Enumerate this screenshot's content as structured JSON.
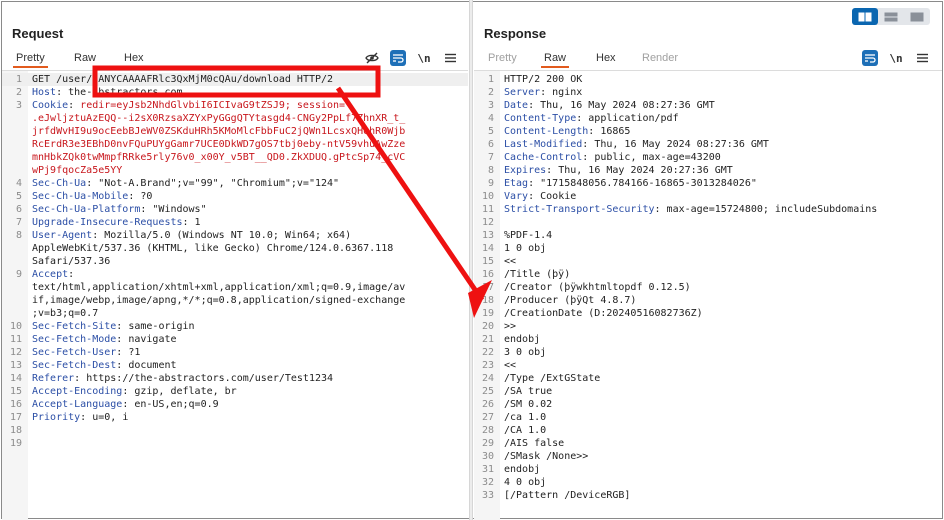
{
  "request": {
    "title": "Request",
    "tabs": [
      {
        "label": "Pretty",
        "active": true,
        "muted": false
      },
      {
        "label": "Raw",
        "active": false,
        "muted": false
      },
      {
        "label": "Hex",
        "active": false,
        "muted": false
      }
    ],
    "newline_label": "\\n",
    "icons": [
      "eye-slash-icon",
      "wrap-icon",
      "menu-icon"
    ],
    "lines": [
      {
        "n": "1",
        "segs": [
          {
            "t": "GET /use",
            "c": "pl"
          },
          {
            "t": "r",
            "c": "pl"
          },
          {
            "t": "/gANYCAAAAFRlc3QxMjM0cQAu/download HTTP/2",
            "c": "pl"
          }
        ]
      },
      {
        "n": "2",
        "segs": [
          {
            "t": "Host",
            "c": "k"
          },
          {
            "t": ": the-abstractors.com",
            "c": "pl"
          }
        ]
      },
      {
        "n": "3",
        "segs": [
          {
            "t": "Cookie",
            "c": "k"
          },
          {
            "t": ": ",
            "c": "pl"
          },
          {
            "t": "redir=eyJsb2NhdGlvbiI6ICIvaG9tZSJ9; session=",
            "c": "cv"
          }
        ]
      },
      {
        "n": "",
        "segs": [
          {
            "t": ".eJwljztuAzEQQ--i2sX0RzsaXZYxPyGGgQTYtasgd4-CNGy2PpLf7ZhnXR_t_",
            "c": "cv"
          }
        ]
      },
      {
        "n": "",
        "segs": [
          {
            "t": "jrfdWvHI9u9ocEebBJeWV0ZSKduHRh5KMoMlcFbbFuC2jQWn1LcsxQHohR0Wjb",
            "c": "cv"
          }
        ]
      },
      {
        "n": "",
        "segs": [
          {
            "t": "RcErdR3e3EBhD0nvFQuPUYgGamr7UCE0DkWD7gOS7tbj0eby-ntV59vhuAwZze",
            "c": "cv"
          }
        ]
      },
      {
        "n": "",
        "segs": [
          {
            "t": "mnHbkZQk0twMmpfRRke5rly76v0_x00Y_v5BT__QD0.ZkXDUQ.gPtcSp74_cVC",
            "c": "cv"
          }
        ]
      },
      {
        "n": "",
        "segs": [
          {
            "t": "wPj9fqocZa5e5YY",
            "c": "cv"
          }
        ]
      },
      {
        "n": "4",
        "segs": [
          {
            "t": "Sec-Ch-Ua",
            "c": "k"
          },
          {
            "t": ": \"Not-A.Brand\";v=\"99\", \"Chromium\";v=\"124\"",
            "c": "pl"
          }
        ]
      },
      {
        "n": "5",
        "segs": [
          {
            "t": "Sec-Ch-Ua-Mobile",
            "c": "k"
          },
          {
            "t": ": ?0",
            "c": "pl"
          }
        ]
      },
      {
        "n": "6",
        "segs": [
          {
            "t": "Sec-Ch-Ua-Platform",
            "c": "k"
          },
          {
            "t": ": \"Windows\"",
            "c": "pl"
          }
        ]
      },
      {
        "n": "7",
        "segs": [
          {
            "t": "Upgrade-Insecure-Requests",
            "c": "k"
          },
          {
            "t": ": 1",
            "c": "pl"
          }
        ]
      },
      {
        "n": "8",
        "segs": [
          {
            "t": "User-Agent",
            "c": "k"
          },
          {
            "t": ": Mozilla/5.0 (Windows NT 10.0; Win64; x64)",
            "c": "pl"
          }
        ]
      },
      {
        "n": "",
        "segs": [
          {
            "t": "AppleWebKit/537.36 (KHTML, like Gecko) Chrome/124.0.6367.118",
            "c": "pl"
          }
        ]
      },
      {
        "n": "",
        "segs": [
          {
            "t": "Safari/537.36",
            "c": "pl"
          }
        ]
      },
      {
        "n": "9",
        "segs": [
          {
            "t": "Accept",
            "c": "k"
          },
          {
            "t": ":",
            "c": "pl"
          }
        ]
      },
      {
        "n": "",
        "segs": [
          {
            "t": "text/html,application/xhtml+xml,application/xml;q=0.9,image/av",
            "c": "pl"
          }
        ]
      },
      {
        "n": "",
        "segs": [
          {
            "t": "if,image/webp,image/apng,*/*;q=0.8,application/signed-exchange",
            "c": "pl"
          }
        ]
      },
      {
        "n": "",
        "segs": [
          {
            "t": ";v=b3;q=0.7",
            "c": "pl"
          }
        ]
      },
      {
        "n": "10",
        "segs": [
          {
            "t": "Sec-Fetch-Site",
            "c": "k"
          },
          {
            "t": ": same-origin",
            "c": "pl"
          }
        ]
      },
      {
        "n": "11",
        "segs": [
          {
            "t": "Sec-Fetch-Mode",
            "c": "k"
          },
          {
            "t": ": navigate",
            "c": "pl"
          }
        ]
      },
      {
        "n": "12",
        "segs": [
          {
            "t": "Sec-Fetch-User",
            "c": "k"
          },
          {
            "t": ": ?1",
            "c": "pl"
          }
        ]
      },
      {
        "n": "13",
        "segs": [
          {
            "t": "Sec-Fetch-Dest",
            "c": "k"
          },
          {
            "t": ": document",
            "c": "pl"
          }
        ]
      },
      {
        "n": "14",
        "segs": [
          {
            "t": "Referer",
            "c": "k"
          },
          {
            "t": ": https://the-abstractors.com/user/Test1234",
            "c": "pl"
          }
        ]
      },
      {
        "n": "15",
        "segs": [
          {
            "t": "Accept-Encoding",
            "c": "k"
          },
          {
            "t": ": gzip, deflate, br",
            "c": "pl"
          }
        ]
      },
      {
        "n": "16",
        "segs": [
          {
            "t": "Accept-Language",
            "c": "k"
          },
          {
            "t": ": en-US,en;q=0.9",
            "c": "pl"
          }
        ]
      },
      {
        "n": "17",
        "segs": [
          {
            "t": "Priority",
            "c": "k"
          },
          {
            "t": ": u=0, i",
            "c": "pl"
          }
        ]
      },
      {
        "n": "18",
        "segs": []
      },
      {
        "n": "19",
        "segs": []
      }
    ]
  },
  "response": {
    "title": "Response",
    "tabs": [
      {
        "label": "Pretty",
        "active": false,
        "muted": true
      },
      {
        "label": "Raw",
        "active": true,
        "muted": false
      },
      {
        "label": "Hex",
        "active": false,
        "muted": false
      },
      {
        "label": "Render",
        "active": false,
        "muted": true
      }
    ],
    "newline_label": "\\n",
    "icons": [
      "wrap-icon",
      "menu-icon"
    ],
    "lines": [
      {
        "n": "1",
        "segs": [
          {
            "t": "HTTP/2 200 OK",
            "c": "pl"
          }
        ]
      },
      {
        "n": "2",
        "segs": [
          {
            "t": "Server",
            "c": "k"
          },
          {
            "t": ": nginx",
            "c": "pl"
          }
        ]
      },
      {
        "n": "3",
        "segs": [
          {
            "t": "Date",
            "c": "k"
          },
          {
            "t": ": Thu, 16 May 2024 08:27:36 GMT",
            "c": "pl"
          }
        ]
      },
      {
        "n": "4",
        "segs": [
          {
            "t": "Content-Type",
            "c": "k"
          },
          {
            "t": ": application/pdf",
            "c": "pl"
          }
        ]
      },
      {
        "n": "5",
        "segs": [
          {
            "t": "Content-Length",
            "c": "k"
          },
          {
            "t": ": 16865",
            "c": "pl"
          }
        ]
      },
      {
        "n": "6",
        "segs": [
          {
            "t": "Last-Modified",
            "c": "k"
          },
          {
            "t": ": Thu, 16 May 2024 08:27:36 GMT",
            "c": "pl"
          }
        ]
      },
      {
        "n": "7",
        "segs": [
          {
            "t": "Cache-Control",
            "c": "k"
          },
          {
            "t": ": public, max-age=43200",
            "c": "pl"
          }
        ]
      },
      {
        "n": "8",
        "segs": [
          {
            "t": "Expires",
            "c": "k"
          },
          {
            "t": ": Thu, 16 May 2024 20:27:36 GMT",
            "c": "pl"
          }
        ]
      },
      {
        "n": "9",
        "segs": [
          {
            "t": "Etag",
            "c": "k"
          },
          {
            "t": ": \"1715848056.784166-16865-3013284026\"",
            "c": "pl"
          }
        ]
      },
      {
        "n": "10",
        "segs": [
          {
            "t": "Vary",
            "c": "k"
          },
          {
            "t": ": Cookie",
            "c": "pl"
          }
        ]
      },
      {
        "n": "11",
        "segs": [
          {
            "t": "Strict-Transport-Security",
            "c": "k"
          },
          {
            "t": ": max-age=15724800; includeSubdomains",
            "c": "pl"
          }
        ]
      },
      {
        "n": "12",
        "segs": []
      },
      {
        "n": "13",
        "segs": [
          {
            "t": "%PDF-1.4",
            "c": "pl"
          }
        ]
      },
      {
        "n": "14",
        "segs": [
          {
            "t": "1 0 obj",
            "c": "pl"
          }
        ]
      },
      {
        "n": "15",
        "segs": [
          {
            "t": "<<",
            "c": "pl"
          }
        ]
      },
      {
        "n": "16",
        "segs": [
          {
            "t": "/Title (þÿ)",
            "c": "pl"
          }
        ]
      },
      {
        "n": "17",
        "segs": [
          {
            "t": "/Creator (þÿwkhtmltopdf 0.12.5)",
            "c": "pl"
          }
        ]
      },
      {
        "n": "18",
        "segs": [
          {
            "t": "/Producer (þÿQt 4.8.7)",
            "c": "pl"
          }
        ]
      },
      {
        "n": "19",
        "segs": [
          {
            "t": "/CreationDate (D:20240516082736Z)",
            "c": "pl"
          }
        ]
      },
      {
        "n": "20",
        "segs": [
          {
            "t": ">>",
            "c": "pl"
          }
        ]
      },
      {
        "n": "21",
        "segs": [
          {
            "t": "endobj",
            "c": "pl"
          }
        ]
      },
      {
        "n": "22",
        "segs": [
          {
            "t": "3 0 obj",
            "c": "pl"
          }
        ]
      },
      {
        "n": "23",
        "segs": [
          {
            "t": "<<",
            "c": "pl"
          }
        ]
      },
      {
        "n": "24",
        "segs": [
          {
            "t": "/Type /ExtGState",
            "c": "pl"
          }
        ]
      },
      {
        "n": "25",
        "segs": [
          {
            "t": "/SA true",
            "c": "pl"
          }
        ]
      },
      {
        "n": "26",
        "segs": [
          {
            "t": "/SM 0.02",
            "c": "pl"
          }
        ]
      },
      {
        "n": "27",
        "segs": [
          {
            "t": "/ca 1.0",
            "c": "pl"
          }
        ]
      },
      {
        "n": "28",
        "segs": [
          {
            "t": "/CA 1.0",
            "c": "pl"
          }
        ]
      },
      {
        "n": "29",
        "segs": [
          {
            "t": "/AIS false",
            "c": "pl"
          }
        ]
      },
      {
        "n": "30",
        "segs": [
          {
            "t": "/SMask /None>>",
            "c": "pl"
          }
        ]
      },
      {
        "n": "31",
        "segs": [
          {
            "t": "endobj",
            "c": "pl"
          }
        ]
      },
      {
        "n": "32",
        "segs": [
          {
            "t": "4 0 obj",
            "c": "pl"
          }
        ]
      },
      {
        "n": "33",
        "segs": [
          {
            "t": "[/Pattern /DeviceRGB]",
            "c": "pl"
          }
        ]
      }
    ]
  },
  "layout_switch": [
    "split-horizontal-icon",
    "split-vertical-icon",
    "single-pane-icon"
  ],
  "colors": {
    "accent": "#e25b1e",
    "header_key": "#2c4fa6",
    "cookie_value": "#c8171d",
    "annotation_red": "#ee1111",
    "button_blue": "#1d6fb7"
  }
}
